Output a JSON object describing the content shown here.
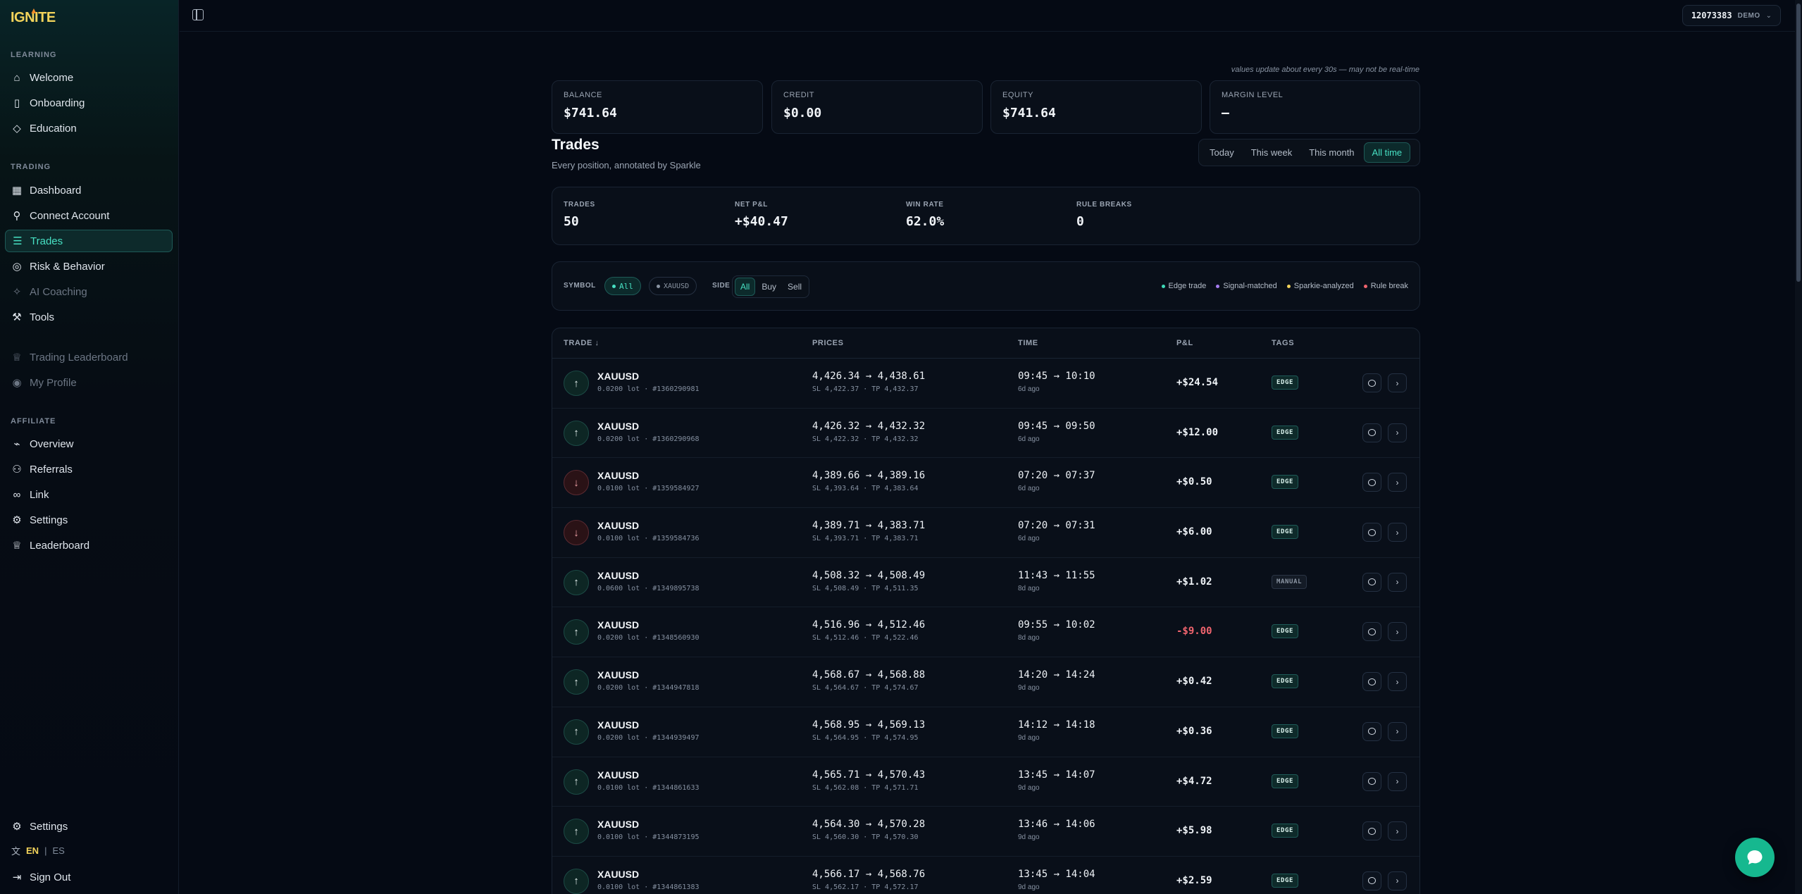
{
  "brand": {
    "logo_text": "IGNITE"
  },
  "sidebar": {
    "sections": {
      "learning": "LEARNING",
      "trading": "TRADING",
      "affiliate": "AFFILIATE"
    },
    "learning_items": [
      {
        "label": "Welcome",
        "icon": "home-icon"
      },
      {
        "label": "Onboarding",
        "icon": "book-icon"
      },
      {
        "label": "Education",
        "icon": "graduation-cap-icon"
      }
    ],
    "trading_items": [
      {
        "label": "Dashboard",
        "icon": "grid-icon"
      },
      {
        "label": "Connect Account",
        "icon": "plug-icon"
      },
      {
        "label": "Trades",
        "icon": "list-icon",
        "active": true
      },
      {
        "label": "Risk & Behavior",
        "icon": "shield-icon"
      },
      {
        "label": "AI Coaching",
        "icon": "sparkle-icon",
        "muted": true
      },
      {
        "label": "Tools",
        "icon": "wrench-icon"
      }
    ],
    "extra_items": [
      {
        "label": "Trading Leaderboard",
        "icon": "trophy-icon",
        "muted": true
      },
      {
        "label": "My Profile",
        "icon": "user-icon",
        "muted": true
      }
    ],
    "affiliate_items": [
      {
        "label": "Overview",
        "icon": "chart-icon"
      },
      {
        "label": "Referrals",
        "icon": "users-icon"
      },
      {
        "label": "Link",
        "icon": "link-icon"
      },
      {
        "label": "Settings",
        "icon": "gear-icon"
      },
      {
        "label": "Leaderboard",
        "icon": "trophy-icon"
      }
    ],
    "bottom": {
      "settings": "Settings",
      "lang_en": "EN",
      "lang_sep": "|",
      "lang_es": "ES",
      "sign_out": "Sign Out"
    }
  },
  "topbar": {
    "account_number": "12073383",
    "account_type": "DEMO"
  },
  "notice": "values update about every 30s — may not be real-time",
  "account_stats": [
    {
      "label": "BALANCE",
      "value": "$741.64"
    },
    {
      "label": "CREDIT",
      "value": "$0.00"
    },
    {
      "label": "EQUITY",
      "value": "$741.64"
    },
    {
      "label": "MARGIN LEVEL",
      "value": "—"
    }
  ],
  "page": {
    "title": "Trades",
    "subtitle": "Every position, annotated by Sparkle"
  },
  "range_tabs": [
    "Today",
    "This week",
    "This month",
    "All time"
  ],
  "range_active": "All time",
  "summary": [
    {
      "label": "TRADES",
      "value": "50"
    },
    {
      "label": "NET P&L",
      "value": "+$40.47"
    },
    {
      "label": "WIN RATE",
      "value": "62.0%"
    },
    {
      "label": "RULE BREAKS",
      "value": "0"
    }
  ],
  "filters": {
    "symbol_label": "SYMBOL",
    "symbol_chips": [
      "All",
      "XAUUSD"
    ],
    "side_label": "SIDE",
    "side_options": [
      "All",
      "Buy",
      "Sell"
    ],
    "legend": [
      {
        "label": "Edge trade",
        "color": "#3ed9b8"
      },
      {
        "label": "Signal-matched",
        "color": "#a57cf0"
      },
      {
        "label": "Sparkie-analyzed",
        "color": "#f2d35b"
      },
      {
        "label": "Rule break",
        "color": "#f0646e"
      }
    ]
  },
  "table": {
    "headers": {
      "trade": "TRADE ↓",
      "prices": "PRICES",
      "time": "TIME",
      "pnl": "P&L",
      "tags": "TAGS"
    },
    "rows": [
      {
        "side": "buy",
        "symbol": "XAUUSD",
        "lot": "0.0200 lot · #1360290981",
        "prices": "4,426.34 → 4,438.61",
        "sltp": "SL 4,422.37 · TP 4,432.37",
        "time": "09:45 → 10:10",
        "ago": "6d ago",
        "pnl": "+$24.54",
        "tag": "EDGE"
      },
      {
        "side": "buy",
        "symbol": "XAUUSD",
        "lot": "0.0200 lot · #1360290968",
        "prices": "4,426.32 → 4,432.32",
        "sltp": "SL 4,422.32 · TP 4,432.32",
        "time": "09:45 → 09:50",
        "ago": "6d ago",
        "pnl": "+$12.00",
        "tag": "EDGE"
      },
      {
        "side": "sell",
        "symbol": "XAUUSD",
        "lot": "0.0100 lot · #1359584927",
        "prices": "4,389.66 → 4,389.16",
        "sltp": "SL 4,393.64 · TP 4,383.64",
        "time": "07:20 → 07:37",
        "ago": "6d ago",
        "pnl": "+$0.50",
        "tag": "EDGE"
      },
      {
        "side": "sell",
        "symbol": "XAUUSD",
        "lot": "0.0100 lot · #1359584736",
        "prices": "4,389.71 → 4,383.71",
        "sltp": "SL 4,393.71 · TP 4,383.71",
        "time": "07:20 → 07:31",
        "ago": "6d ago",
        "pnl": "+$6.00",
        "tag": "EDGE"
      },
      {
        "side": "buy",
        "symbol": "XAUUSD",
        "lot": "0.0600 lot · #1349895738",
        "prices": "4,508.32 → 4,508.49",
        "sltp": "SL 4,508.49 · TP 4,511.35",
        "time": "11:43 → 11:55",
        "ago": "8d ago",
        "pnl": "+$1.02",
        "tag": "MANUAL"
      },
      {
        "side": "buy",
        "symbol": "XAUUSD",
        "lot": "0.0200 lot · #1348560930",
        "prices": "4,516.96 → 4,512.46",
        "sltp": "SL 4,512.46 · TP 4,522.46",
        "time": "09:55 → 10:02",
        "ago": "8d ago",
        "pnl": "-$9.00",
        "tag": "EDGE",
        "negative": true
      },
      {
        "side": "buy",
        "symbol": "XAUUSD",
        "lot": "0.0200 lot · #1344947818",
        "prices": "4,568.67 → 4,568.88",
        "sltp": "SL 4,564.67 · TP 4,574.67",
        "time": "14:20 → 14:24",
        "ago": "9d ago",
        "pnl": "+$0.42",
        "tag": "EDGE"
      },
      {
        "side": "buy",
        "symbol": "XAUUSD",
        "lot": "0.0200 lot · #1344939497",
        "prices": "4,568.95 → 4,569.13",
        "sltp": "SL 4,564.95 · TP 4,574.95",
        "time": "14:12 → 14:18",
        "ago": "9d ago",
        "pnl": "+$0.36",
        "tag": "EDGE"
      },
      {
        "side": "buy",
        "symbol": "XAUUSD",
        "lot": "0.0100 lot · #1344861633",
        "prices": "4,565.71 → 4,570.43",
        "sltp": "SL 4,562.08 · TP 4,571.71",
        "time": "13:45 → 14:07",
        "ago": "9d ago",
        "pnl": "+$4.72",
        "tag": "EDGE"
      },
      {
        "side": "buy",
        "symbol": "XAUUSD",
        "lot": "0.0100 lot · #1344873195",
        "prices": "4,564.30 → 4,570.28",
        "sltp": "SL 4,560.30 · TP 4,570.30",
        "time": "13:46 → 14:06",
        "ago": "9d ago",
        "pnl": "+$5.98",
        "tag": "EDGE"
      },
      {
        "side": "buy",
        "symbol": "XAUUSD",
        "lot": "0.0100 lot · #1344861383",
        "prices": "4,566.17 → 4,568.76",
        "sltp": "SL 4,562.17 · TP 4,572.17",
        "time": "13:45 → 14:04",
        "ago": "9d ago",
        "pnl": "+$2.59",
        "tag": "EDGE"
      }
    ]
  },
  "colors": {
    "accent": "#47e0c3",
    "background": "#050a14",
    "negative": "#f0646e",
    "brand": "#f2d35b",
    "chat_button": "#16b88f"
  }
}
